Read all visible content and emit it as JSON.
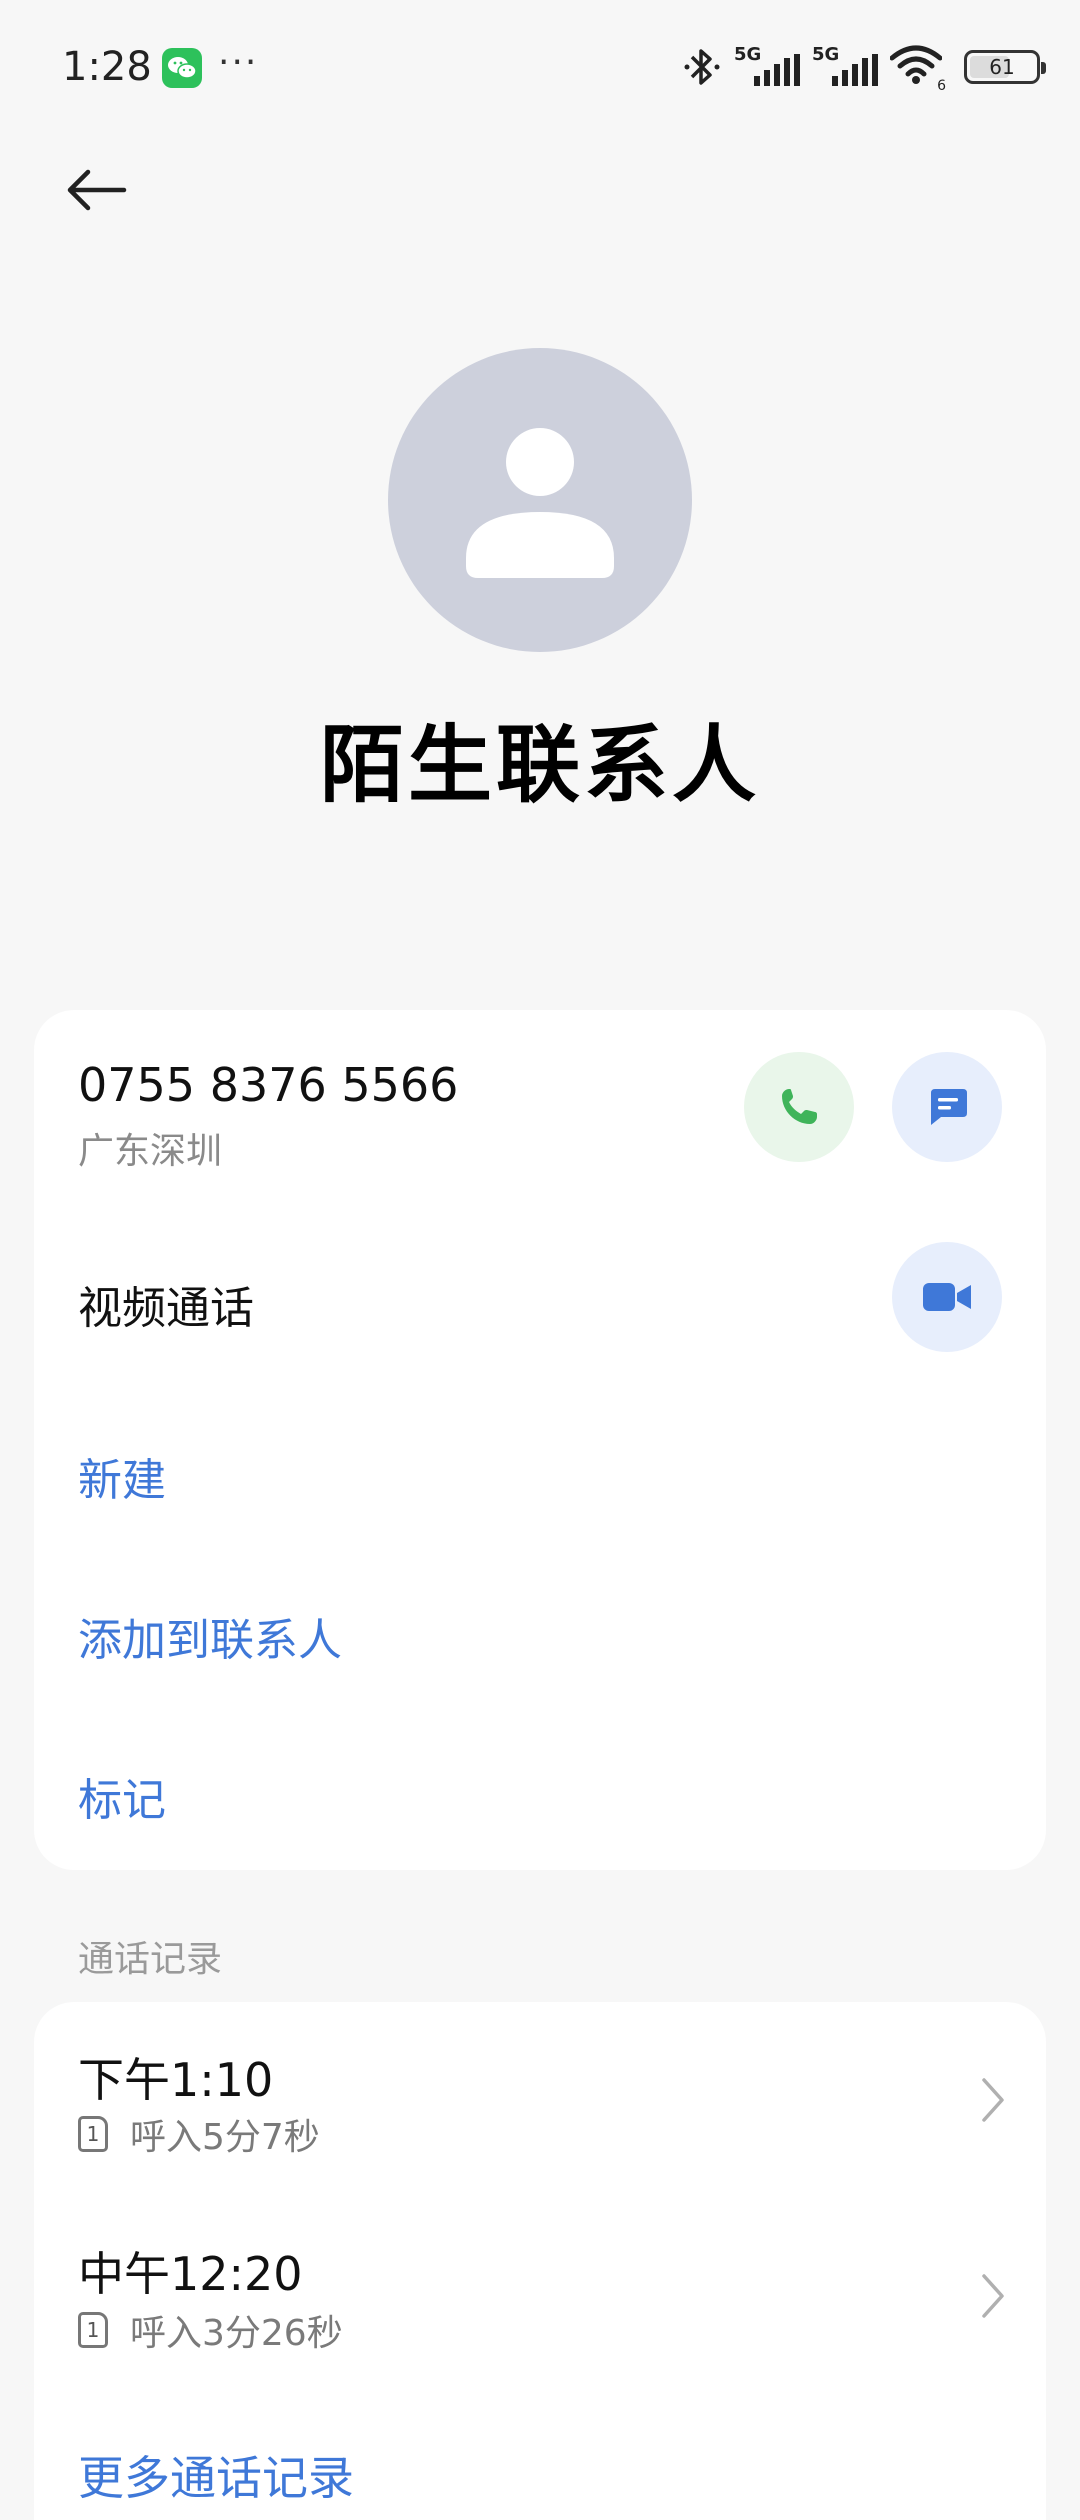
{
  "status_bar": {
    "time": "1:28",
    "app_icon": "wechat-icon",
    "dots": "···",
    "network_1": "5G",
    "network_2": "5G",
    "wifi_label": "6",
    "battery": "61",
    "battery_level": 0.61
  },
  "header": {
    "back_icon": "arrow-left-icon",
    "avatar_icon": "person-icon",
    "title": "陌生联系人"
  },
  "contact": {
    "phone_number": "0755 8376 5566",
    "location": "广东深圳",
    "call_icon": "phone-icon",
    "message_icon": "message-icon",
    "video_call_label": "视频通话",
    "video_icon": "video-camera-icon",
    "actions": {
      "new": "新建",
      "add_to_contacts": "添加到联系人",
      "mark": "标记"
    }
  },
  "call_log": {
    "section_title": "通话记录",
    "entries": [
      {
        "time": "下午1:10",
        "sim": "1",
        "detail": "呼入5分7秒"
      },
      {
        "time": "中午12:20",
        "sim": "1",
        "detail": "呼入3分26秒"
      }
    ],
    "more_label": "更多通话记录"
  },
  "colors": {
    "background": "#f7f7f7",
    "card": "#ffffff",
    "accent_blue": "#3f78d8",
    "call_green": "#3fb45a",
    "avatar_gray": "#cdd0dc"
  }
}
